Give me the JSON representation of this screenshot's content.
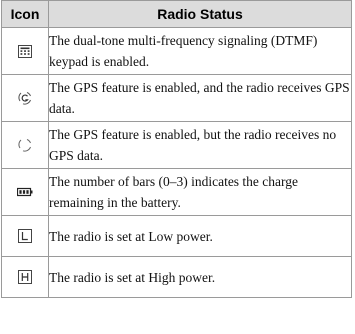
{
  "table": {
    "headers": {
      "icon": "Icon",
      "status": "Radio Status"
    },
    "rows": [
      {
        "icon": "keypad-icon",
        "text": "The dual-tone multi-frequency signaling (DTMF) keypad is enabled."
      },
      {
        "icon": "gps-data-icon",
        "text": "The GPS feature is enabled, and the radio receives GPS data."
      },
      {
        "icon": "gps-no-data-icon",
        "text": "The GPS feature is enabled, but the radio receives no GPS data."
      },
      {
        "icon": "battery-icon",
        "text": "The number of bars (0–3) indicates the charge remaining in the battery."
      },
      {
        "icon": "low-power-icon",
        "text": "The radio is set at Low power."
      },
      {
        "icon": "high-power-icon",
        "text": "The radio is set at High power."
      }
    ]
  }
}
